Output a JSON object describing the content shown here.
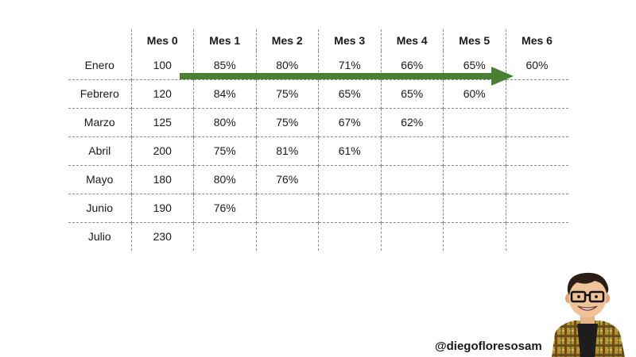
{
  "table": {
    "headers": [
      "",
      "Mes 0",
      "Mes 1",
      "Mes 2",
      "Mes 3",
      "Mes 4",
      "Mes 5",
      "Mes 6"
    ],
    "rows": [
      {
        "label": "Enero",
        "cells": [
          "100",
          "85%",
          "80%",
          "71%",
          "66%",
          "65%",
          "60%"
        ]
      },
      {
        "label": "Febrero",
        "cells": [
          "120",
          "84%",
          "75%",
          "65%",
          "65%",
          "60%",
          ""
        ]
      },
      {
        "label": "Marzo",
        "cells": [
          "125",
          "80%",
          "75%",
          "67%",
          "62%",
          "",
          ""
        ]
      },
      {
        "label": "Abril",
        "cells": [
          "200",
          "75%",
          "81%",
          "61%",
          "",
          "",
          ""
        ]
      },
      {
        "label": "Mayo",
        "cells": [
          "180",
          "80%",
          "76%",
          "",
          "",
          "",
          ""
        ]
      },
      {
        "label": "Junio",
        "cells": [
          "190",
          "76%",
          "",
          "",
          "",
          "",
          ""
        ]
      },
      {
        "label": "Julio",
        "cells": [
          "230",
          "",
          "",
          "",
          "",
          "",
          ""
        ]
      }
    ]
  },
  "arrow": {
    "color": "#4a7f33",
    "icon": "right-arrow-icon"
  },
  "footer": {
    "handle": "@diegofloresosam"
  },
  "avatar": {
    "icon": "cartoon-avatar-icon"
  }
}
